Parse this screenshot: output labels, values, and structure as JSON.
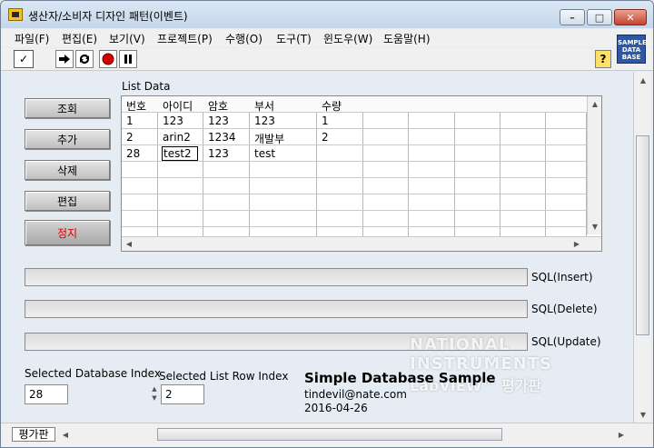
{
  "window": {
    "title": "생산자/소비자 디자인 패턴(이벤트)"
  },
  "menu": [
    "파일(F)",
    "편집(E)",
    "보기(V)",
    "프로젝트(P)",
    "수행(O)",
    "도구(T)",
    "윈도우(W)",
    "도움말(H)"
  ],
  "toolbar": {
    "run_glyph": "✓",
    "help_glyph": "?"
  },
  "ni_icon": {
    "line1": "SAMPLE",
    "line2": "DATA",
    "line3": "BASE"
  },
  "buttons": {
    "query": "조회",
    "add": "추가",
    "delete": "삭제",
    "edit": "편집",
    "stop": "정지"
  },
  "list": {
    "label": "List Data",
    "headers": [
      "번호",
      "아이디",
      "암호",
      "부서",
      "수량"
    ],
    "rows": [
      [
        "1",
        "123",
        "123",
        "123",
        "1"
      ],
      [
        "2",
        "arin2",
        "1234",
        "개발부",
        "2"
      ],
      [
        "28",
        "test2",
        "123",
        "test",
        ""
      ]
    ]
  },
  "sql": {
    "insert": "SQL(Insert)",
    "delete": "SQL(Delete)",
    "update": "SQL(Update)"
  },
  "selected_db": {
    "label": "Selected Database Index",
    "value": "28"
  },
  "selected_row": {
    "label": "Selected List Row Index",
    "value": "2"
  },
  "sample": {
    "title": "Simple Database Sample",
    "email": "tindevil@nate.com",
    "date": "2016-04-26"
  },
  "watermark": {
    "line1": "NATIONAL",
    "line2": "INSTRUMENTS",
    "line3": "LabVIEW™ 평가판"
  },
  "status": {
    "label": "평가판"
  }
}
